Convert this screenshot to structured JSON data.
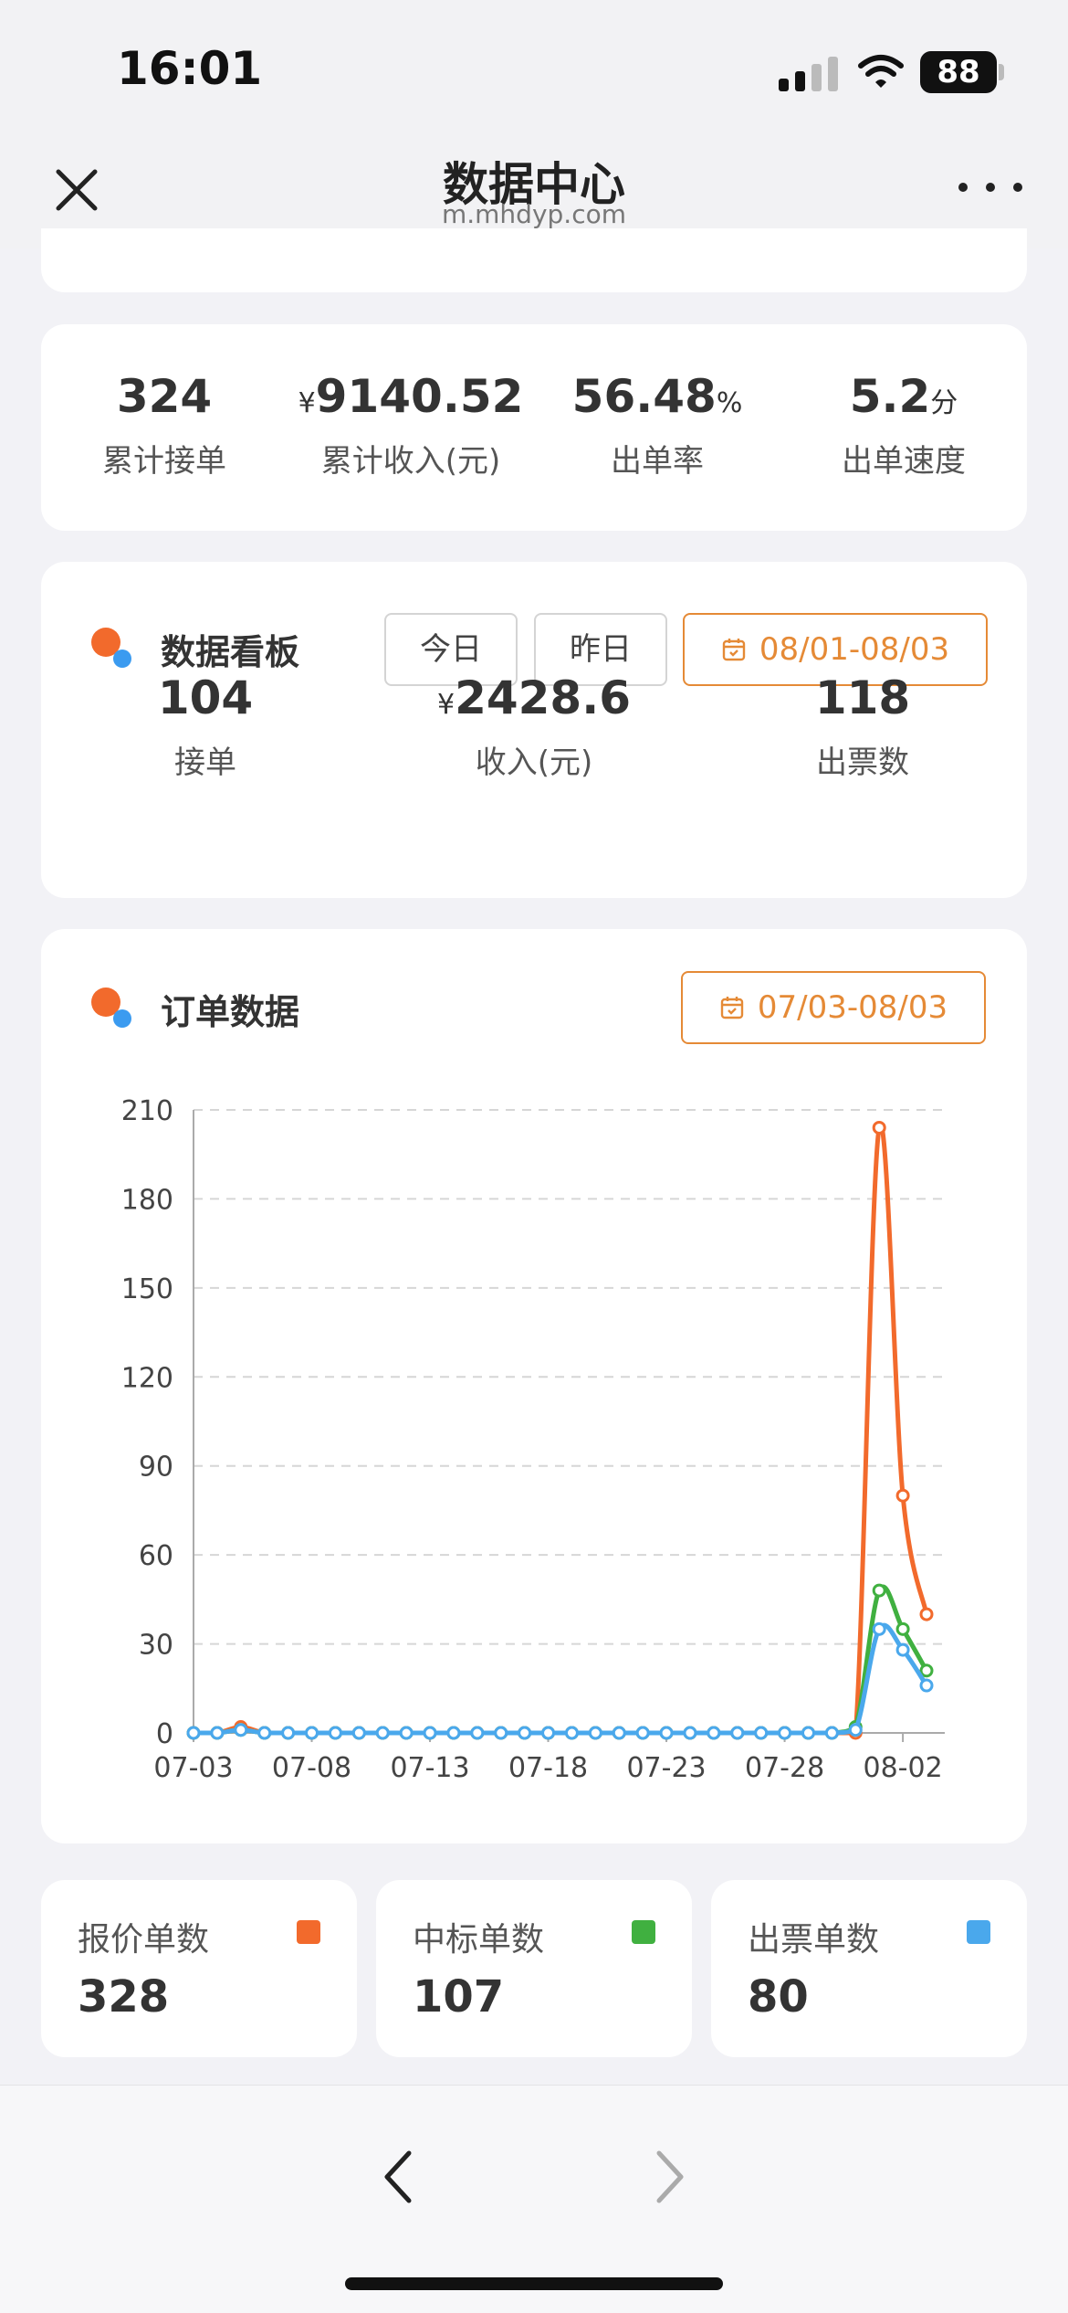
{
  "status_bar": {
    "time": "16:01",
    "battery": "88"
  },
  "header": {
    "title": "数据中心",
    "url": "m.mhdyp.com"
  },
  "summary": [
    {
      "prefix": "",
      "value": "324",
      "suffix": "",
      "label": "累计接单"
    },
    {
      "prefix": "¥",
      "value": "9140.52",
      "suffix": "",
      "label": "累计收入(元)"
    },
    {
      "prefix": "",
      "value": "56.48",
      "suffix": "%",
      "label": "出单率"
    },
    {
      "prefix": "",
      "value": "5.2",
      "suffix": "分",
      "label": "出单速度"
    }
  ],
  "dashboard": {
    "title": "数据看板",
    "today_label": "今日",
    "yesterday_label": "昨日",
    "range_label": "08/01-08/03",
    "stats": [
      {
        "prefix": "",
        "value": "104",
        "label": "接单"
      },
      {
        "prefix": "¥",
        "value": "2428.6",
        "label": "收入(元)"
      },
      {
        "prefix": "",
        "value": "118",
        "label": "出票数"
      }
    ]
  },
  "orders": {
    "title": "订单数据",
    "range_label": "07/03-08/03"
  },
  "chart_data": {
    "type": "line",
    "x": [
      "07-03",
      "07-04",
      "07-05",
      "07-06",
      "07-07",
      "07-08",
      "07-09",
      "07-10",
      "07-11",
      "07-12",
      "07-13",
      "07-14",
      "07-15",
      "07-16",
      "07-17",
      "07-18",
      "07-19",
      "07-20",
      "07-21",
      "07-22",
      "07-23",
      "07-24",
      "07-25",
      "07-26",
      "07-27",
      "07-28",
      "07-29",
      "07-30",
      "07-31",
      "08-01",
      "08-02",
      "08-03"
    ],
    "xticks": [
      "07-03",
      "07-08",
      "07-13",
      "07-18",
      "07-23",
      "07-28",
      "08-02"
    ],
    "yticks": [
      0,
      30,
      60,
      90,
      120,
      150,
      180,
      210
    ],
    "ylim": [
      0,
      210
    ],
    "grid": true,
    "series": [
      {
        "name": "报价单数",
        "color": "#f26a2c",
        "values": [
          0,
          0,
          2,
          0,
          0,
          0,
          0,
          0,
          0,
          0,
          0,
          0,
          0,
          0,
          0,
          0,
          0,
          0,
          0,
          0,
          0,
          0,
          0,
          0,
          0,
          0,
          0,
          0,
          0,
          204,
          80,
          40
        ]
      },
      {
        "name": "中标单数",
        "color": "#40b040",
        "values": [
          0,
          0,
          1,
          0,
          0,
          0,
          0,
          0,
          0,
          0,
          0,
          0,
          0,
          0,
          0,
          0,
          0,
          0,
          0,
          0,
          0,
          0,
          0,
          0,
          0,
          0,
          0,
          0,
          2,
          48,
          35,
          21
        ]
      },
      {
        "name": "出票单数",
        "color": "#4aa8ec",
        "values": [
          0,
          0,
          1,
          0,
          0,
          0,
          0,
          0,
          0,
          0,
          0,
          0,
          0,
          0,
          0,
          0,
          0,
          0,
          0,
          0,
          0,
          0,
          0,
          0,
          0,
          0,
          0,
          0,
          1,
          35,
          28,
          16
        ]
      }
    ]
  },
  "legend": [
    {
      "label": "报价单数",
      "value": "328",
      "color": "#f26a2c"
    },
    {
      "label": "中标单数",
      "value": "107",
      "color": "#40b040"
    },
    {
      "label": "出票单数",
      "value": "80",
      "color": "#4aa8ec"
    }
  ]
}
